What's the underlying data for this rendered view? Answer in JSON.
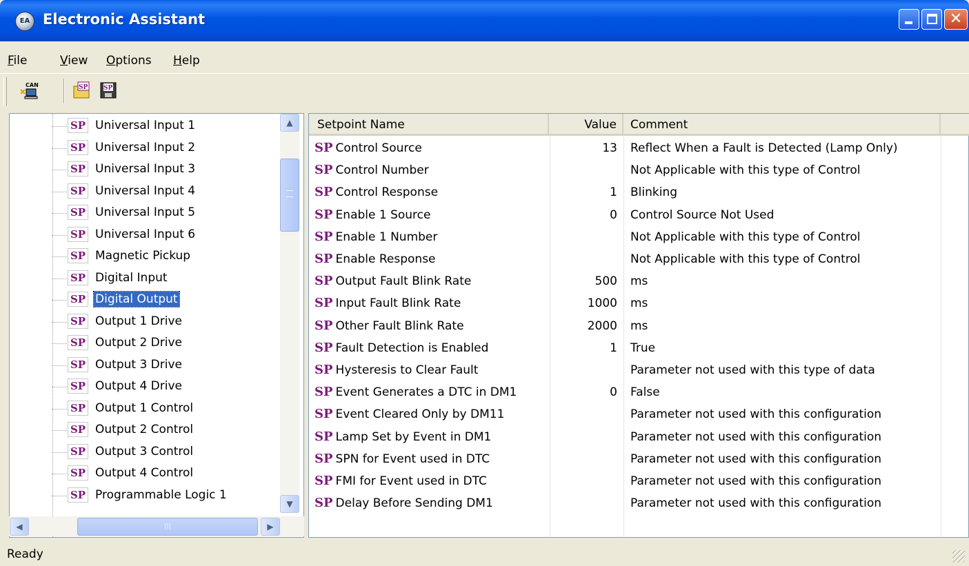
{
  "window": {
    "title": "Electronic Assistant",
    "icon_text": "EA"
  },
  "menu": [
    {
      "label_u": "F",
      "label_rest": "ile"
    },
    {
      "label_u": "V",
      "label_rest": "iew"
    },
    {
      "label_u": "O",
      "label_rest": "ptions"
    },
    {
      "label_u": "H",
      "label_rest": "elp"
    }
  ],
  "toolbar": {
    "buttons": [
      "can-connect-icon",
      "open-setpoint-icon",
      "save-setpoint-icon"
    ]
  },
  "tree": {
    "icon_text": "SP",
    "items": [
      "Universal Input 1",
      "Universal Input 2",
      "Universal Input 3",
      "Universal Input 4",
      "Universal Input 5",
      "Universal Input 6",
      "Magnetic Pickup",
      "Digital Input",
      "Digital Output",
      "Output 1 Drive",
      "Output 2 Drive",
      "Output 3 Drive",
      "Output 4 Drive",
      "Output 1 Control",
      "Output 2 Control",
      "Output 3 Control",
      "Output 4 Control",
      "Programmable Logic 1"
    ],
    "selected": "Digital Output"
  },
  "grid": {
    "columns": [
      "Setpoint Name",
      "Value",
      "Comment"
    ],
    "sp_mark": "SP",
    "rows": [
      {
        "name": "Control Source",
        "value": "13",
        "comment": "Reflect When a Fault is Detected (Lamp Only)"
      },
      {
        "name": "Control Number",
        "value": "",
        "comment": "Not Applicable with this type of Control"
      },
      {
        "name": "Control Response",
        "value": "1",
        "comment": "Blinking"
      },
      {
        "name": "Enable 1 Source",
        "value": "0",
        "comment": "Control Source Not Used"
      },
      {
        "name": "Enable 1 Number",
        "value": "",
        "comment": "Not Applicable with this type of Control"
      },
      {
        "name": "Enable Response",
        "value": "",
        "comment": "Not Applicable with this type of Control"
      },
      {
        "name": "Output Fault Blink Rate",
        "value": "500",
        "comment": "ms"
      },
      {
        "name": "Input Fault Blink Rate",
        "value": "1000",
        "comment": "ms"
      },
      {
        "name": "Other Fault Blink Rate",
        "value": "2000",
        "comment": "ms"
      },
      {
        "name": "Fault Detection is Enabled",
        "value": "1",
        "comment": "True"
      },
      {
        "name": "Hysteresis to Clear Fault",
        "value": "",
        "comment": "Parameter not used with this type of data"
      },
      {
        "name": "Event Generates a DTC in DM1",
        "value": "0",
        "comment": "False"
      },
      {
        "name": "Event Cleared Only by DM11",
        "value": "",
        "comment": "Parameter not used with this configuration"
      },
      {
        "name": "Lamp Set by Event in DM1",
        "value": "",
        "comment": "Parameter not used with this configuration"
      },
      {
        "name": "SPN for Event used in DTC",
        "value": "",
        "comment": "Parameter not used with this configuration"
      },
      {
        "name": "FMI for Event used in DTC",
        "value": "",
        "comment": "Parameter not used with this configuration"
      },
      {
        "name": "Delay Before Sending DM1",
        "value": "",
        "comment": "Parameter not used with this configuration"
      }
    ]
  },
  "status": {
    "text": "Ready"
  }
}
